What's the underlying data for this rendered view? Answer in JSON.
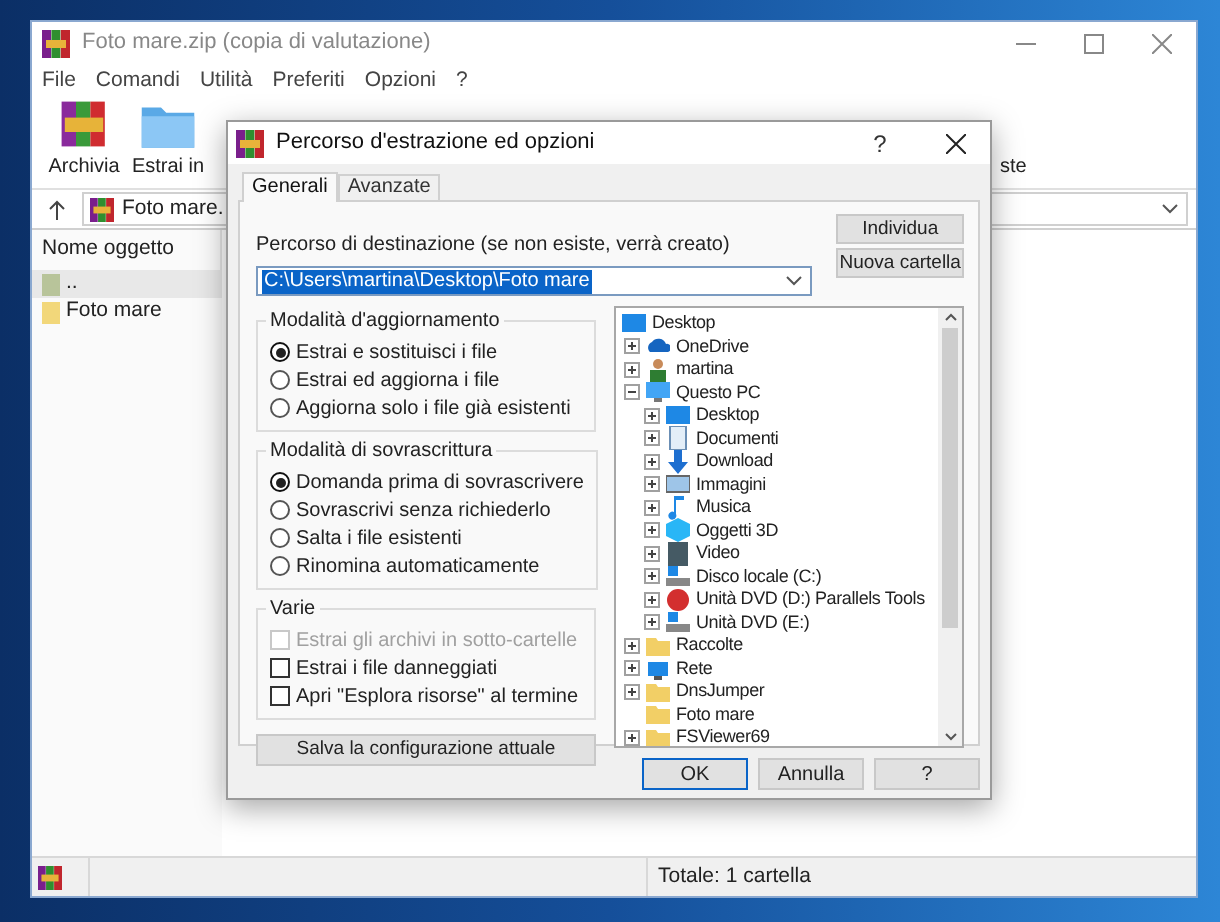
{
  "window": {
    "title": "Foto mare.zip (copia di valutazione)"
  },
  "menu": [
    "File",
    "Comandi",
    "Utilità",
    "Preferiti",
    "Opzioni",
    "?"
  ],
  "toolbar": {
    "left": [
      {
        "label": "Archivia",
        "kind": "books"
      },
      {
        "label": "Estrai in",
        "kind": "folder"
      }
    ],
    "right": {
      "label": "ste"
    }
  },
  "address": {
    "value": "Foto mare."
  },
  "file_list": {
    "column": "Nome oggetto",
    "rows": [
      {
        "name": "..",
        "kind": "up",
        "selected": true
      },
      {
        "name": "Foto mare",
        "kind": "folder",
        "selected": false
      }
    ]
  },
  "status_bar": {
    "text": "Totale: 1 cartella"
  },
  "dialog": {
    "title": "Percorso d'estrazione ed opzioni",
    "title_help": "?",
    "tabs": [
      {
        "label": "Generali",
        "selected": true
      },
      {
        "label": "Avanzate",
        "selected": false
      }
    ],
    "destination_label": "Percorso di destinazione (se non esiste, verrà creato)",
    "destination_value": "C:\\Users\\martina\\Desktop\\Foto mare",
    "side_buttons": [
      "Individua",
      "Nuova cartella"
    ],
    "update_mode": {
      "title": "Modalità d'aggiornamento",
      "options": [
        {
          "label": "Estrai e sostituisci i file",
          "selected": true
        },
        {
          "label": "Estrai ed aggiorna i file",
          "selected": false
        },
        {
          "label": "Aggiorna solo i file già esistenti",
          "selected": false
        }
      ]
    },
    "overwrite_mode": {
      "title": "Modalità di sovrascrittura",
      "options": [
        {
          "label": "Domanda prima di sovrascrivere",
          "selected": true
        },
        {
          "label": "Sovrascrivi senza richiederlo",
          "selected": false
        },
        {
          "label": "Salta i file esistenti",
          "selected": false
        },
        {
          "label": "Rinomina automaticamente",
          "selected": false
        }
      ]
    },
    "misc": {
      "title": "Varie",
      "options": [
        {
          "label": "Estrai gli archivi in sotto-cartelle",
          "checked": false,
          "disabled": true
        },
        {
          "label": "Estrai i file danneggiati",
          "checked": false,
          "disabled": false
        },
        {
          "label": "Apri \"Esplora risorse\" al termine",
          "checked": false,
          "disabled": false
        }
      ]
    },
    "save_button": "Salva la configurazione attuale",
    "tree": [
      {
        "label": "Desktop",
        "kind": "desktop",
        "children": [
          {
            "label": "OneDrive",
            "kind": "cloud",
            "expanded": false
          },
          {
            "label": "martina",
            "kind": "user",
            "expanded": false
          },
          {
            "label": "Questo PC",
            "kind": "pc",
            "expanded": true,
            "children": [
              {
                "label": "Desktop",
                "kind": "desktop",
                "expanded": false
              },
              {
                "label": "Documenti",
                "kind": "docs",
                "expanded": false
              },
              {
                "label": "Download",
                "kind": "download",
                "expanded": false
              },
              {
                "label": "Immagini",
                "kind": "images",
                "expanded": false
              },
              {
                "label": "Musica",
                "kind": "music",
                "expanded": false
              },
              {
                "label": "Oggetti 3D",
                "kind": "cube",
                "expanded": false
              },
              {
                "label": "Video",
                "kind": "video",
                "expanded": false
              },
              {
                "label": "Disco locale (C:)",
                "kind": "drive",
                "expanded": false
              },
              {
                "label": "Unità DVD (D:) Parallels Tools",
                "kind": "dvd",
                "expanded": false
              },
              {
                "label": "Unità DVD (E:)",
                "kind": "drive",
                "expanded": false
              }
            ]
          },
          {
            "label": "Raccolte",
            "kind": "folder",
            "expanded": false
          },
          {
            "label": "Rete",
            "kind": "network",
            "expanded": false
          },
          {
            "label": "DnsJumper",
            "kind": "folder",
            "expanded": false
          },
          {
            "label": "Foto mare",
            "kind": "folder"
          },
          {
            "label": "FSViewer69",
            "kind": "folder",
            "expanded": false
          }
        ]
      }
    ],
    "buttons": [
      {
        "label": "OK",
        "default": true
      },
      {
        "label": "Annulla",
        "default": false
      },
      {
        "label": "?",
        "default": false
      }
    ]
  }
}
